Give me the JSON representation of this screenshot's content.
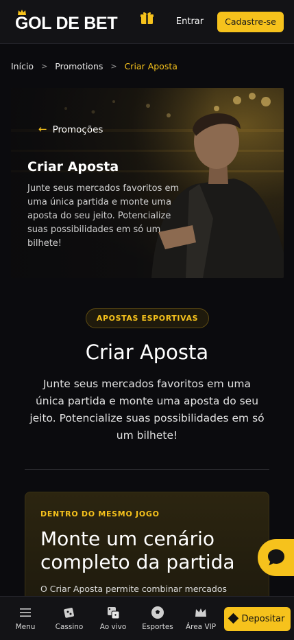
{
  "header": {
    "logo_text": "GOL DE BET",
    "gift_icon": "gift-icon",
    "login_label": "Entrar",
    "signup_label": "Cadastre-se"
  },
  "breadcrumb": {
    "items": [
      "Início",
      "Promotions",
      "Criar Aposta"
    ],
    "separator": ">"
  },
  "hero": {
    "back_label": "Promoções",
    "title": "Criar Aposta",
    "description": "Junte seus mercados favoritos em uma única partida e monte uma aposta do seu jeito. Potencialize suas possibilidades em só um bilhete!"
  },
  "main": {
    "tag": "APOSTAS ESPORTIVAS",
    "title": "Criar Aposta",
    "description": "Junte seus mercados favoritos em uma única partida e monte uma aposta do seu jeito. Potencialize suas possibilidades em só um bilhete!"
  },
  "card": {
    "kicker": "DENTRO DO MESMO JOGO",
    "title": "Monte um cenário completo da partida",
    "description": "O Criar Aposta permite combinar mercados"
  },
  "chat": {
    "icon": "chat-bubble-icon"
  },
  "bottom_nav": {
    "items": [
      {
        "label": "Menu",
        "icon": "menu-icon"
      },
      {
        "label": "Cassino",
        "icon": "casino-icon"
      },
      {
        "label": "Ao vivo",
        "icon": "dice-icon"
      },
      {
        "label": "Esportes",
        "icon": "soccer-ball-icon"
      },
      {
        "label": "Área VIP",
        "icon": "crown-icon"
      }
    ],
    "deposit_label": "Depositar"
  },
  "colors": {
    "accent": "#f6c21c",
    "background": "#0b0b0e",
    "header": "#131316"
  }
}
